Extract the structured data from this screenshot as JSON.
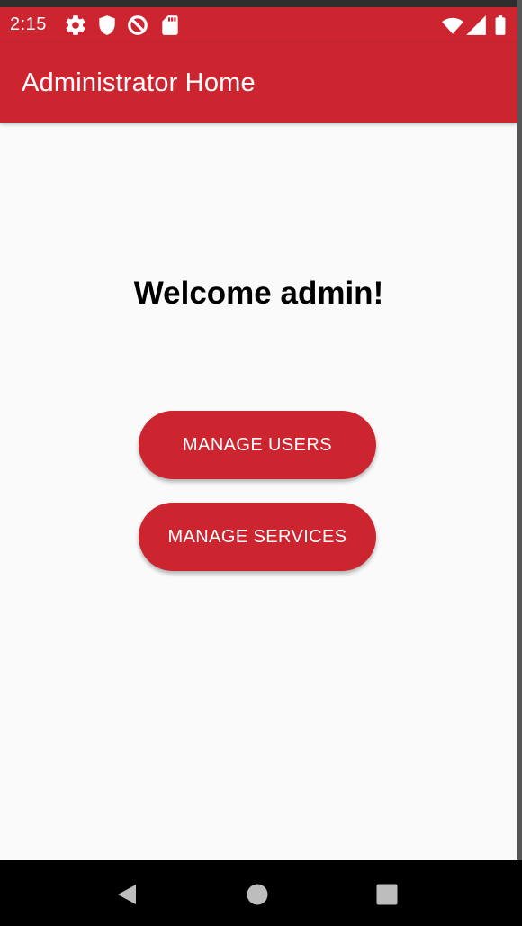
{
  "status_bar": {
    "time": "2:15",
    "icons": [
      "gear-icon",
      "shield-icon",
      "no-disturb-icon",
      "sd-card-icon",
      "wifi-icon",
      "signal-icon",
      "battery-icon"
    ]
  },
  "app_bar": {
    "title": "Administrator Home"
  },
  "main": {
    "welcome_text": "Welcome admin!",
    "buttons": [
      {
        "label": "MANAGE USERS"
      },
      {
        "label": "MANAGE SERVICES"
      }
    ]
  },
  "nav_bar": {
    "icons": [
      "back-icon",
      "home-icon",
      "recents-icon"
    ]
  },
  "colors": {
    "primary": "#cc2530",
    "background": "#fafafa",
    "on_primary": "#ffffff"
  }
}
